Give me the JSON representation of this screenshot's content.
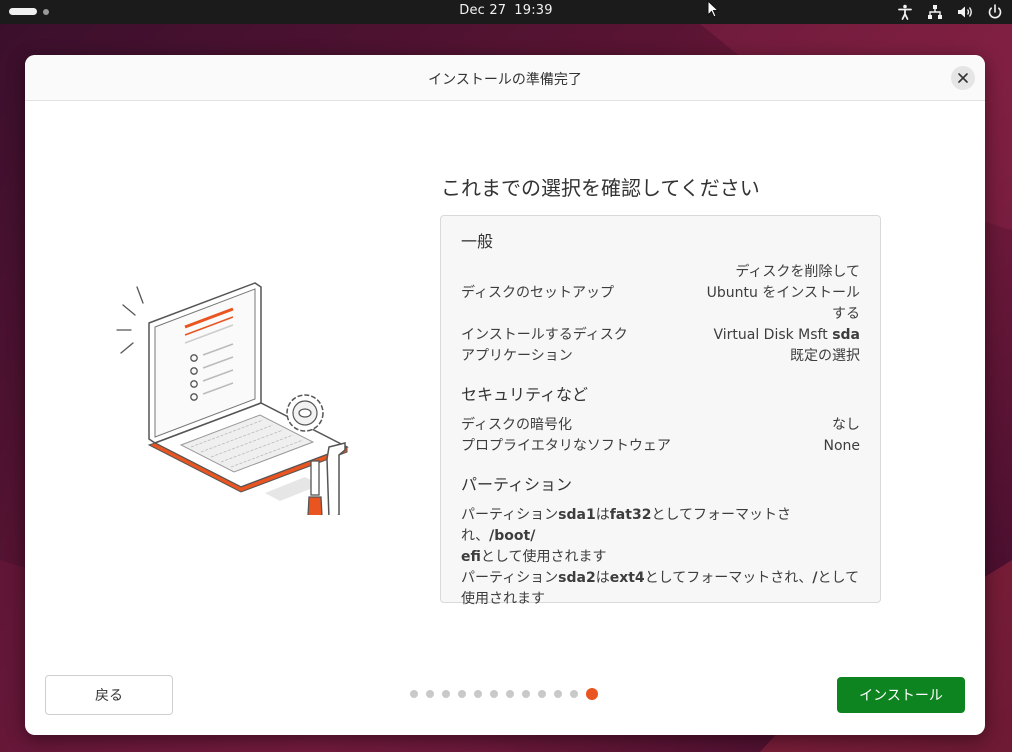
{
  "topbar": {
    "date": "Dec 27",
    "time": "19:39",
    "tray_icons": [
      "accessibility-icon",
      "network-icon",
      "volume-icon",
      "power-icon"
    ]
  },
  "dialog": {
    "title": "インストールの準備完了",
    "heading": "これまでの選択を確認してください",
    "general": {
      "title": "一般",
      "disk_setup_label": "ディスクのセットアップ",
      "disk_setup_value": [
        "ディスクを削除して",
        "Ubuntu をインストール",
        "する"
      ],
      "install_disk_label": "インストールするディスク",
      "install_disk_value": "Virtual Disk Msft",
      "install_disk_device": "sda",
      "apps_label": "アプリケーション",
      "apps_value": "既定の選択"
    },
    "security": {
      "title": "セキュリティなど",
      "encryption_label": "ディスクの暗号化",
      "encryption_value": "なし",
      "proprietary_label": "プロプライエタリなソフトウェア",
      "proprietary_value": "None"
    },
    "partitions": {
      "title": "パーティション",
      "p1": {
        "prefix": "パーティション",
        "device": "sda1",
        "mid1": "は",
        "fs": "fat32",
        "mid2": "としてフォーマットされ、",
        "mount_a": "/boot/",
        "mount_b": "efi",
        "suffix": "として使用されます"
      },
      "p2": {
        "prefix": "パーティション",
        "device": "sda2",
        "mid1": "は",
        "fs": "ext4",
        "mid2": "としてフォーマットされ、",
        "mount": "/",
        "suffix_a": "として",
        "suffix_b": "使用されます"
      }
    },
    "back_label": "戻る",
    "install_label": "インストール",
    "progress": {
      "total_steps": 12,
      "current_step": 12
    }
  },
  "colors": {
    "accent": "#e95420",
    "install_button": "#0e8420"
  }
}
